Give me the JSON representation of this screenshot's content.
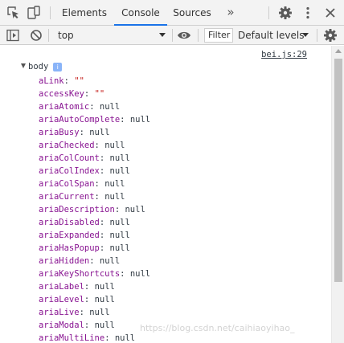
{
  "tabs": {
    "items": [
      {
        "label": "Elements"
      },
      {
        "label": "Console"
      },
      {
        "label": "Sources"
      }
    ],
    "more": "»"
  },
  "toolbar": {
    "context": "top",
    "filter_label": "Filter",
    "levels": "Default levels"
  },
  "console": {
    "source_link": "bei.js:29",
    "object_label": "body",
    "info_badge": "i",
    "properties": [
      {
        "key": "aLink",
        "value": "\"\"",
        "kind": "string"
      },
      {
        "key": "accessKey",
        "value": "\"\"",
        "kind": "string"
      },
      {
        "key": "ariaAtomic",
        "value": "null",
        "kind": "null"
      },
      {
        "key": "ariaAutoComplete",
        "value": "null",
        "kind": "null"
      },
      {
        "key": "ariaBusy",
        "value": "null",
        "kind": "null"
      },
      {
        "key": "ariaChecked",
        "value": "null",
        "kind": "null"
      },
      {
        "key": "ariaColCount",
        "value": "null",
        "kind": "null"
      },
      {
        "key": "ariaColIndex",
        "value": "null",
        "kind": "null"
      },
      {
        "key": "ariaColSpan",
        "value": "null",
        "kind": "null"
      },
      {
        "key": "ariaCurrent",
        "value": "null",
        "kind": "null"
      },
      {
        "key": "ariaDescription",
        "value": "null",
        "kind": "null"
      },
      {
        "key": "ariaDisabled",
        "value": "null",
        "kind": "null"
      },
      {
        "key": "ariaExpanded",
        "value": "null",
        "kind": "null"
      },
      {
        "key": "ariaHasPopup",
        "value": "null",
        "kind": "null"
      },
      {
        "key": "ariaHidden",
        "value": "null",
        "kind": "null"
      },
      {
        "key": "ariaKeyShortcuts",
        "value": "null",
        "kind": "null"
      },
      {
        "key": "ariaLabel",
        "value": "null",
        "kind": "null"
      },
      {
        "key": "ariaLevel",
        "value": "null",
        "kind": "null"
      },
      {
        "key": "ariaLive",
        "value": "null",
        "kind": "null"
      },
      {
        "key": "ariaModal",
        "value": "null",
        "kind": "null"
      },
      {
        "key": "ariaMultiLine",
        "value": "null",
        "kind": "null"
      }
    ]
  },
  "watermark": "https://blog.csdn.net/caihiaoyihao_",
  "colors": {
    "property_key": "#881391",
    "string_value": "#c41a16",
    "active_tab_underline": "#1a73e8",
    "toolbar_bg": "#f3f3f3"
  }
}
